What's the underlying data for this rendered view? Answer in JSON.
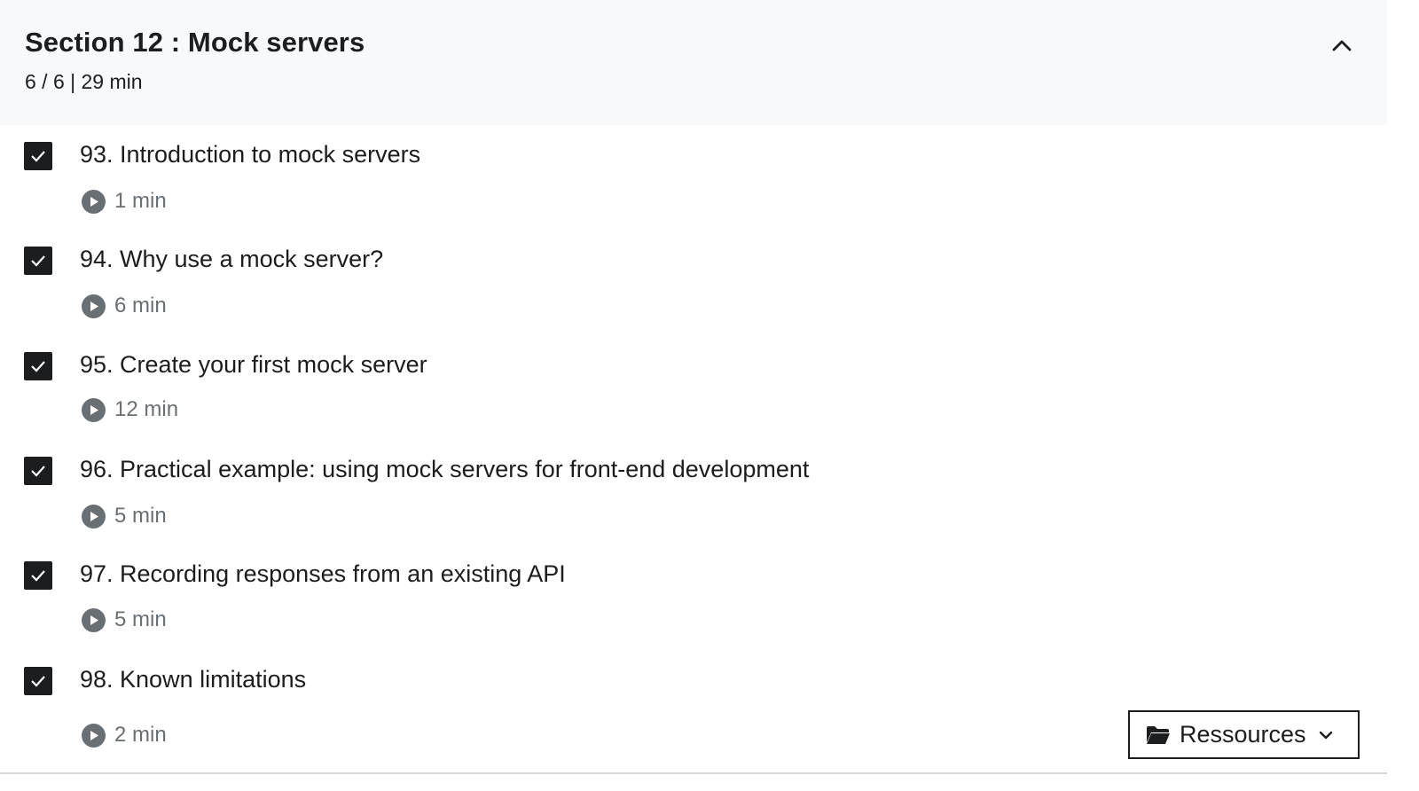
{
  "section": {
    "title": "Section 12 : Mock servers",
    "meta": "6 / 6 | 29 min",
    "collapse_icon": "chevron-up-icon"
  },
  "lectures": [
    {
      "title": "93. Introduction to mock servers",
      "duration": "1 min",
      "completed": true
    },
    {
      "title": "94. Why use a mock server?",
      "duration": "6 min",
      "completed": true
    },
    {
      "title": "95. Create your first mock server",
      "duration": "12 min",
      "completed": true
    },
    {
      "title": "96. Practical example: using mock servers for front-end development",
      "duration": "5 min",
      "completed": true
    },
    {
      "title": "97. Recording responses from an existing API",
      "duration": "5 min",
      "completed": true
    },
    {
      "title": "98. Known limitations",
      "duration": "2 min",
      "completed": true
    }
  ],
  "resources": {
    "label": "Ressources",
    "icon": "folder-icon",
    "dropdown_icon": "chevron-down-icon"
  },
  "colors": {
    "header_bg": "#f7f9fa",
    "text": "#1c1d1f",
    "muted": "#6a6f73"
  }
}
